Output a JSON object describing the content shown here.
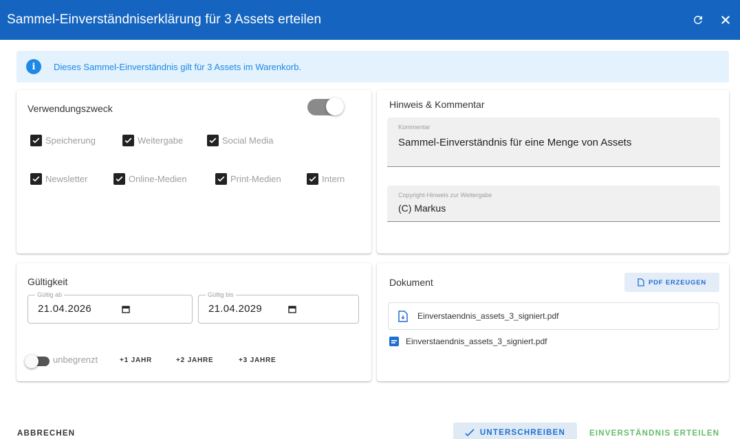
{
  "header": {
    "title": "Sammel-Einverständniserklärung für 3 Assets erteilen",
    "refresh_icon": "refresh-icon",
    "close_icon": "close-icon"
  },
  "info": {
    "icon": "info-icon",
    "text": "Dieses Sammel-Einverständnis gilt für 3 Assets im Warenkorb."
  },
  "usage": {
    "title": "Verwendungszweck",
    "toggle_on": true,
    "checkboxes": [
      {
        "label": "Speicherung",
        "checked": true
      },
      {
        "label": "Weitergabe",
        "checked": true
      },
      {
        "label": "Social Media",
        "checked": true
      },
      {
        "label": "Newsletter",
        "checked": true
      },
      {
        "label": "Online-Medien",
        "checked": true
      },
      {
        "label": "Print-Medien",
        "checked": true
      },
      {
        "label": "Intern",
        "checked": true
      }
    ]
  },
  "notes": {
    "title": "Hinweis & Kommentar",
    "comment_label": "Kommentar",
    "comment_value": "Sammel-Einverständnis für eine Menge von Assets",
    "copyright_label": "Copyright-Hinweis zur Weitergabe",
    "copyright_value": "(C) Markus"
  },
  "validity": {
    "title": "Gültigkeit",
    "from_label": "Gültig ab",
    "from_value": "21.04.2026",
    "to_label": "Gültig bis",
    "to_value": "21.04.2029",
    "unlimited_label": "unbegrenzt",
    "unlimited_on": false,
    "plus1": "+1 JAHR",
    "plus2": "+2 JAHRE",
    "plus3": "+3 JAHRE"
  },
  "document": {
    "title": "Dokument",
    "pdf_button": "PDF ERZEUGEN",
    "file_primary": "Einverstaendnis_assets_3_signiert.pdf",
    "file_secondary": "Einverstaendnis_assets_3_signiert.pdf"
  },
  "footer": {
    "cancel": "ABBRECHEN",
    "sign": "UNTERSCHREIBEN",
    "grant": "EINVERSTÄNDNIS ERTEILEN"
  },
  "colors": {
    "header_bg": "#1565c0",
    "info_bg": "#e3f2fd",
    "accent_blue": "#1e88e5",
    "grant_green": "#66bb6a"
  }
}
